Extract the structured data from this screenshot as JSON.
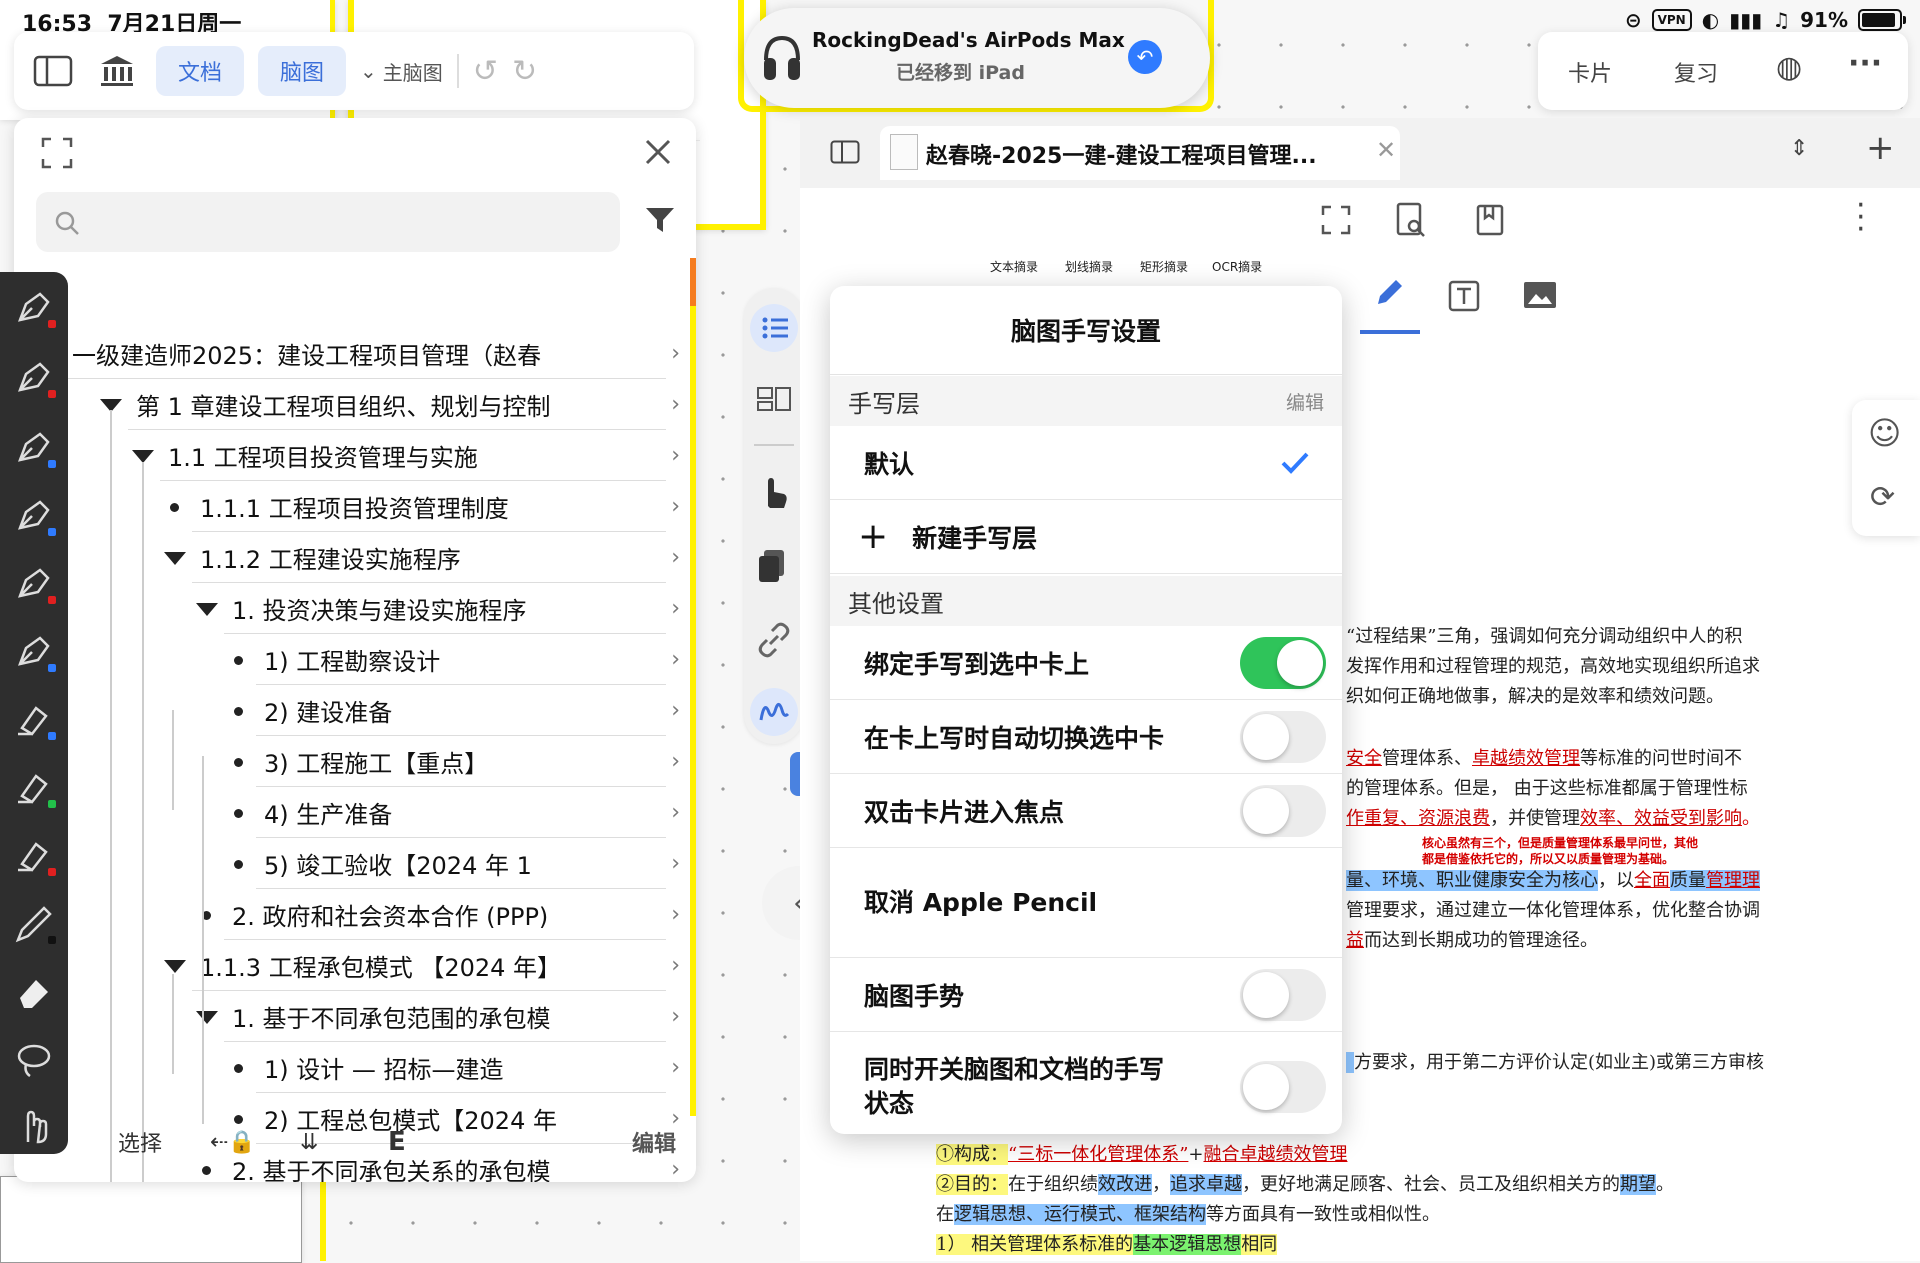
{
  "status_bar": {
    "time": "16:53",
    "date": "7月21日周一",
    "vpn": "VPN",
    "battery": "91%",
    "battery_level": 0.91
  },
  "toolbar": {
    "tab_doc": "文档",
    "tab_mindmap": "脑图",
    "dropdown_label": "主脑图"
  },
  "airpods": {
    "title": "RockingDead's AirPods Max",
    "subtitle": "已经移到 iPad"
  },
  "right_toolbar": {
    "card": "卡片",
    "review": "复习"
  },
  "outline": {
    "rows": [
      {
        "text": "一级建造师2025：建设工程项目管理（赵春",
        "level": 0,
        "marker": "none"
      },
      {
        "text": "第 1 章建设工程项目组织、规划与控制",
        "level": 1,
        "marker": "tri"
      },
      {
        "text": "1.1 工程项目投资管理与实施",
        "level": 2,
        "marker": "tri"
      },
      {
        "text": "1.1.1 工程项目投资管理制度",
        "level": 3,
        "marker": "dot"
      },
      {
        "text": "1.1.2 工程建设实施程序",
        "level": 3,
        "marker": "tri"
      },
      {
        "text": "1. 投资决策与建设实施程序",
        "level": 4,
        "marker": "tri"
      },
      {
        "text": "1) 工程勘察设计",
        "level": 5,
        "marker": "dot"
      },
      {
        "text": "2) 建设准备",
        "level": 5,
        "marker": "dot"
      },
      {
        "text": "3) 工程施工【重点】",
        "level": 5,
        "marker": "dot"
      },
      {
        "text": "4) 生产准备",
        "level": 5,
        "marker": "dot"
      },
      {
        "text": "5) 竣工验收【2024 年 1",
        "level": 5,
        "marker": "dot"
      },
      {
        "text": "2. 政府和社会资本合作 (PPP)",
        "level": 4,
        "marker": "dot"
      },
      {
        "text": "1.1.3 工程承包模式 【2024 年】",
        "level": 3,
        "marker": "tri"
      },
      {
        "text": "1. 基于不同承包范围的承包模",
        "level": 4,
        "marker": "tri"
      },
      {
        "text": "1) 设计 — 招标—建造",
        "level": 5,
        "marker": "dot"
      },
      {
        "text": "2) 工程总包模式【2024 年",
        "level": 5,
        "marker": "dot"
      },
      {
        "text": "2. 基于不同承包关系的承包模",
        "level": 4,
        "marker": "dot"
      }
    ],
    "bottom_select": "选择",
    "bottom_edit": "编辑"
  },
  "document": {
    "tab_title": "赵春晓-2025一建-建设工程项目管理...",
    "captions": [
      "文本摘录",
      "划线摘录",
      "矩形摘录",
      "OCR摘录"
    ],
    "para1": [
      "“过程结果”三角，强调如何充分调动组织中人的积",
      "发挥作用和过程管理的规范，高效地实现组织所追求",
      "织如何正确地做事，解决的是效率和绩效问题。"
    ],
    "para2_l1_a": "安全",
    "para2_l1_b": "管理体系、",
    "para2_l1_c": "卓越绩效管理",
    "para2_l1_d": "等标准的问世时间不",
    "para2_l2": "的管理体系。但是，  由于这些标准都属于管理性标",
    "para2_l3_a": "作重复、资源浪费",
    "para2_l3_b": "，并使管理",
    "para2_l3_c": "效率、效益受到影响",
    "para2_l3_d": "。",
    "annotation1": "核心虽然有三个，但是质量管理体系最早问世，其他",
    "annotation2": "都是借鉴依托它的，所以又以质量管理为基础。",
    "para3_l1_a": "量、环境、职业健康安全为核心",
    "para3_l1_b": "，以",
    "para3_l1_c": "全面",
    "para3_l1_d": "质量",
    "para3_l1_e": "管理理",
    "para3_l2": "管理要求，通过建立一体化管理体系，优化整合协调",
    "para3_l3_a": "益",
    "para3_l3_b": "而达到长期成功的管理途径。",
    "para4": "方要求，用于第二方评价认定(如业主)或第三方审核",
    "list1_a": "①构成：",
    "list1_b": "“三标一体化管理体系”",
    "list1_c": "+",
    "list1_d": "融合卓越绩效管理",
    "list2_a": "②目的：",
    "list2_b": "在于组织绩",
    "list2_c": "效改进",
    "list2_d": "，",
    "list2_e": "追求卓越",
    "list2_f": "，更好地满足顾客、社会、员工及组织相关方的",
    "list2_g": "期望",
    "list2_h": "。",
    "list3_a": "在",
    "list3_b": "逻辑思想、运行模式、框架结构",
    "list3_c": "等方面具有一致性或相似性。",
    "list4_a": "1）  相关管理体系标准的",
    "list4_b": "基本逻辑思想",
    "list4_c": "相同"
  },
  "popover": {
    "title": "脑图手写设置",
    "section_layers": "手写层",
    "section_layers_edit": "编辑",
    "layer_default": "默认",
    "new_layer": "新建手写层",
    "section_other": "其他设置",
    "settings": [
      {
        "label": "绑定手写到选中卡上",
        "on": true
      },
      {
        "label": "在卡上写时自动切换选中卡",
        "on": false
      },
      {
        "label": "双击卡片进入焦点",
        "on": false
      },
      {
        "label": "取消 Apple Pencil",
        "on": null
      },
      {
        "label": "脑图手势",
        "on": false
      },
      {
        "label": "同时开关脑图和文档的手写状态",
        "on": false
      }
    ]
  },
  "colors": {
    "accent": "#3b6fd9",
    "toggle_on": "#2fc45a",
    "yellow_border": "#fff100",
    "scroll_orange": "#f57c1f"
  }
}
